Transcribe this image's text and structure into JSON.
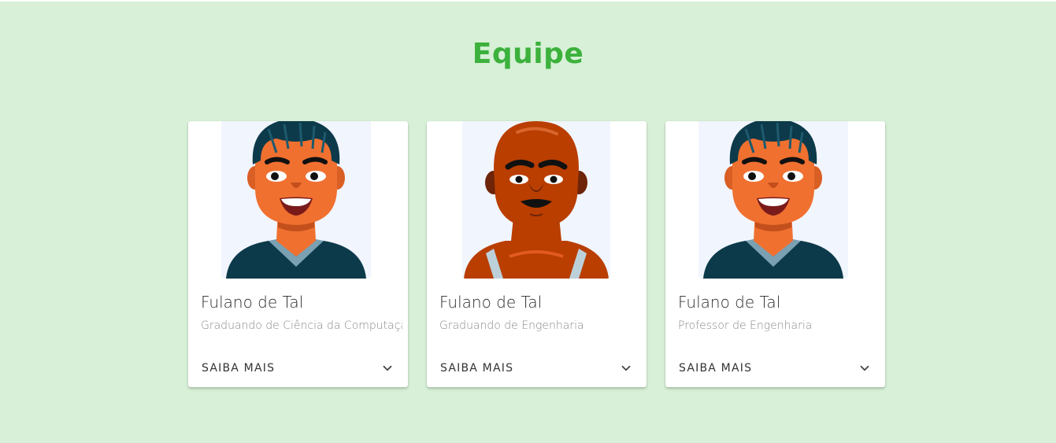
{
  "page": {
    "title": "Equipe"
  },
  "colors": {
    "background": "#d7f0d7",
    "title": "#3cb13c",
    "card": "#ffffff",
    "avatar_bg": "#f1f5fe"
  },
  "team": [
    {
      "name": "Fulano de Tal",
      "role": "Graduando de Ciência da Computação",
      "action_label": "SAIBA MAIS",
      "avatar": "young-man-avatar",
      "icon": "chevron-down-icon"
    },
    {
      "name": "Fulano de Tal",
      "role": "Graduando de Engenharia",
      "action_label": "SAIBA MAIS",
      "avatar": "bald-man-avatar",
      "icon": "chevron-down-icon"
    },
    {
      "name": "Fulano de Tal",
      "role": "Professor de Engenharia",
      "action_label": "SAIBA MAIS",
      "avatar": "young-man-avatar",
      "icon": "chevron-down-icon"
    }
  ]
}
